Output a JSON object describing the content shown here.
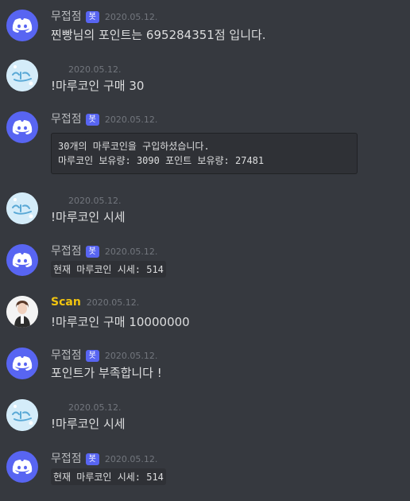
{
  "bot_badge": "봇",
  "messages": [
    {
      "author": "무접점",
      "timestamp": "2020.05.12.",
      "text": "찐빵님의 포인트는 695284351점 입니다."
    },
    {
      "timestamp": "2020.05.12.",
      "text": "!마루코인 구매 30"
    },
    {
      "author": "무접점",
      "timestamp": "2020.05.12.",
      "code_lines": [
        "30개의 마루코인을 구입하셨습니다.",
        "마루코인 보유량: 3090 포인트 보유량: 27481"
      ]
    },
    {
      "timestamp": "2020.05.12.",
      "text": "!마루코인 시세"
    },
    {
      "author": "무접점",
      "timestamp": "2020.05.12.",
      "code": "현재 마루코인 시세: 514"
    },
    {
      "author": "Scan",
      "timestamp": "2020.05.12.",
      "text": "!마루코인 구매 10000000"
    },
    {
      "author": "무접점",
      "timestamp": "2020.05.12.",
      "text": "포인트가 부족합니다 !"
    },
    {
      "timestamp": "2020.05.12.",
      "text": "!마루코인 시세"
    },
    {
      "author": "무접점",
      "timestamp": "2020.05.12.",
      "code": "현재 마루코인 시세: 514"
    }
  ],
  "colors": {
    "background": "#36393f",
    "bot_badge": "#5865f2",
    "scan_name": "#f1c40f"
  },
  "icons": {
    "bot_avatar": "discord-logo",
    "user_avatar": "maru-avatar",
    "scan_avatar": "person-avatar"
  }
}
